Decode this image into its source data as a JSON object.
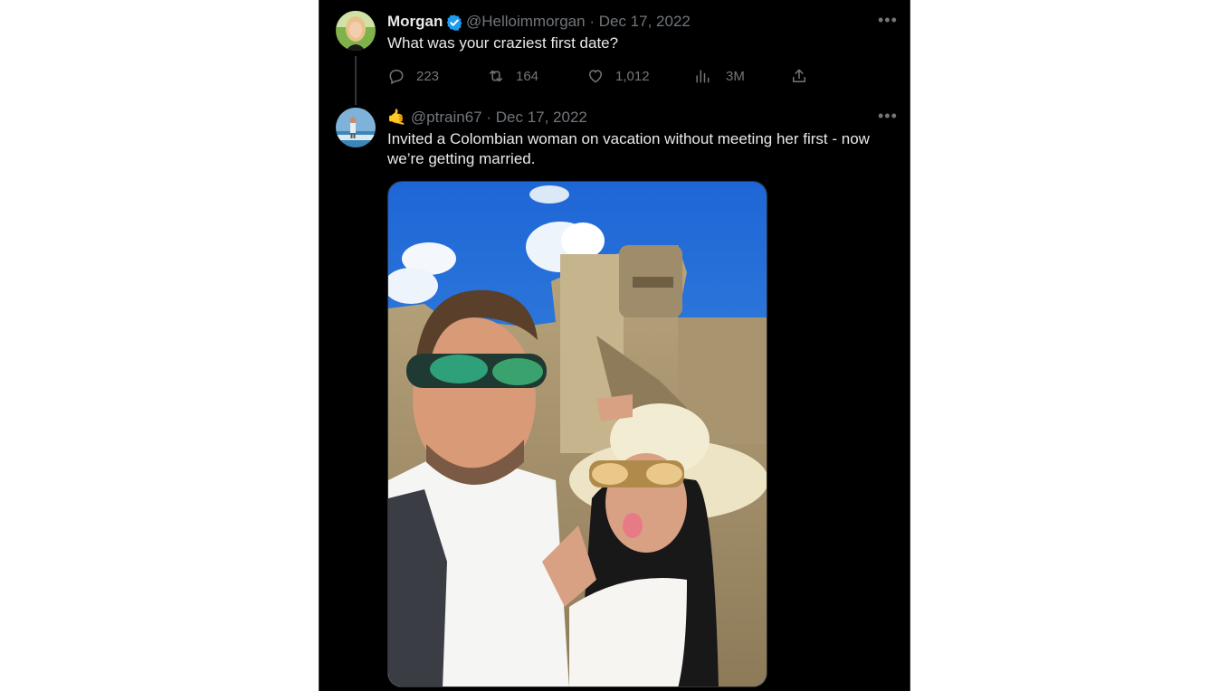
{
  "tweet1": {
    "display_name": "Morgan",
    "verified_icon": "verified-badge-icon",
    "handle": "@Helloimmorgan",
    "separator": "·",
    "date": "Dec 17, 2022",
    "text": "What was your craziest first date?",
    "more_icon": "more-horizontal-icon",
    "actions": {
      "reply_count": "223",
      "retweet_count": "164",
      "like_count": "1,012",
      "views_count": "3M"
    }
  },
  "tweet2": {
    "emoji": "🤙",
    "handle": "@ptrain67",
    "separator": "·",
    "date": "Dec 17, 2022",
    "text_line1": "Invited a Colombian woman on vacation without meeting her first - now",
    "text_line2": "we’re getting married.",
    "more_icon": "more-horizontal-icon",
    "media_icon": "selfie-photo"
  },
  "colors": {
    "background": "#000000",
    "text": "#e7e9ea",
    "muted": "#71767b",
    "verified": "#1d9bf0"
  }
}
